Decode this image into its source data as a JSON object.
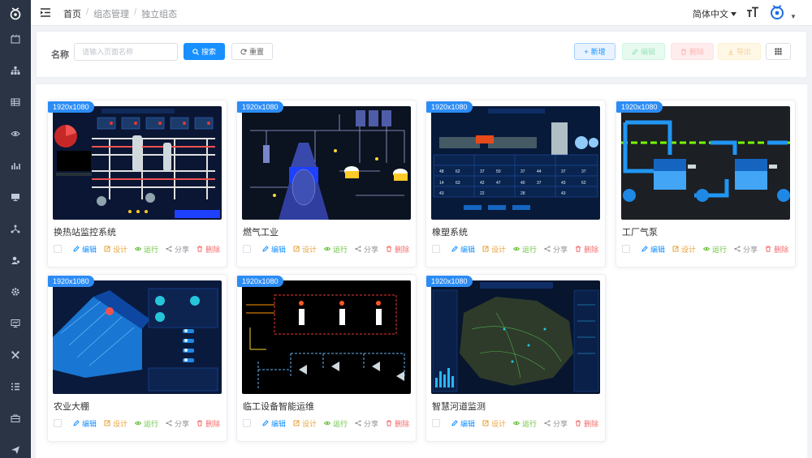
{
  "breadcrumb": {
    "home": "首页",
    "level2": "组态管理",
    "level3": "独立组态"
  },
  "header": {
    "language": "简体中文"
  },
  "search": {
    "label": "名称",
    "placeholder": "请输入页面名称"
  },
  "buttons": {
    "search": "搜索",
    "reset": "重置",
    "add": "新增",
    "edit": "编辑",
    "delete": "删除",
    "export": "导出"
  },
  "card_actions": {
    "edit": "编辑",
    "design": "设计",
    "run": "运行",
    "share": "分享",
    "delete": "删除"
  },
  "cards": [
    {
      "resolution": "1920x1080",
      "title": "换热站监控系统"
    },
    {
      "resolution": "1920x1080",
      "title": "燃气工业"
    },
    {
      "resolution": "1920x1080",
      "title": "橡塑系统"
    },
    {
      "resolution": "1920x1080",
      "title": "工厂气泵"
    },
    {
      "resolution": "1920x1080",
      "title": "农业大棚"
    },
    {
      "resolution": "1920x1080",
      "title": "临工设备智能运维"
    },
    {
      "resolution": "1920x1080",
      "title": "智慧河道监测"
    }
  ],
  "colors": {
    "primary": "#1890ff",
    "sidebar": "#2b3444",
    "badge": "#2c8cf5"
  }
}
